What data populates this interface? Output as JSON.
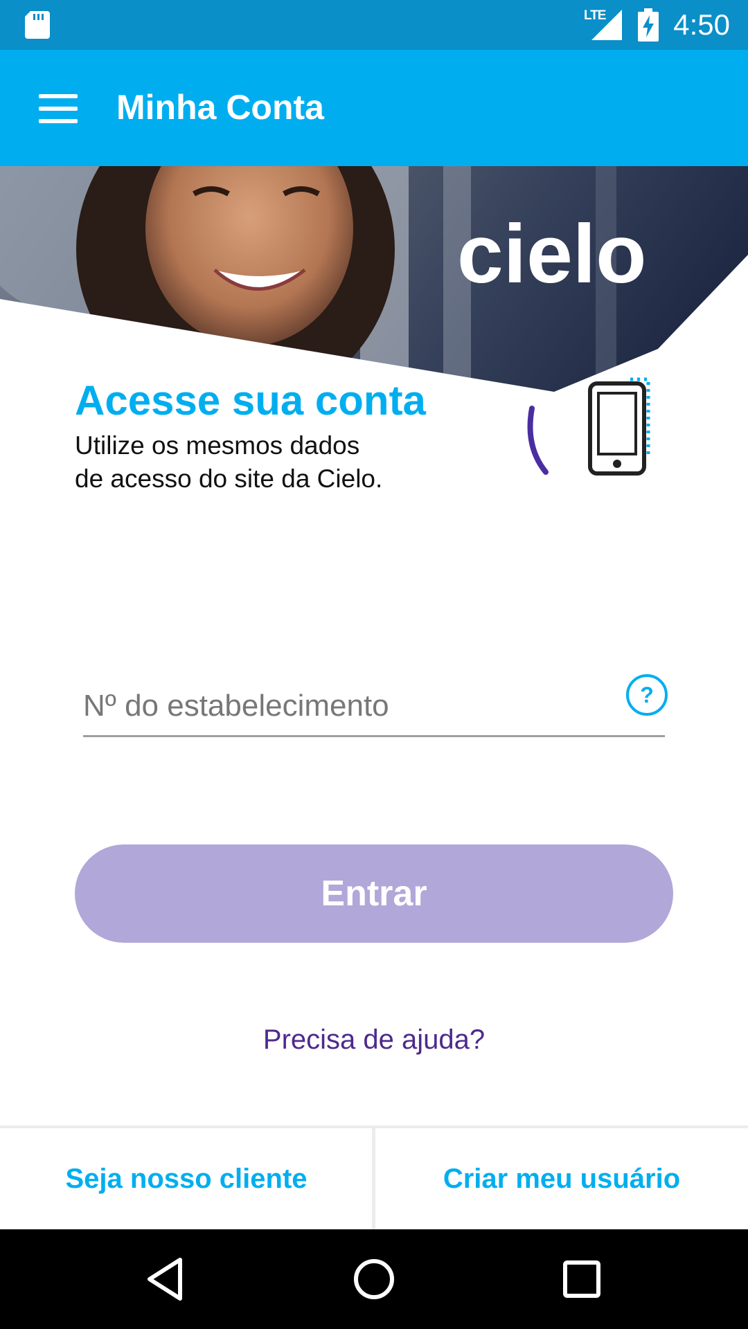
{
  "status_bar": {
    "time": "4:50",
    "network_label": "LTE",
    "icons": [
      "sd-card-icon",
      "lte-signal-icon",
      "battery-charging-icon"
    ]
  },
  "app_bar": {
    "title": "Minha Conta",
    "menu_icon": "menu-icon"
  },
  "hero": {
    "logo_text": "cielo",
    "headline": "Acesse sua conta",
    "subline_1": "Utilize os mesmos dados",
    "subline_2": "de acesso do site da Cielo."
  },
  "form": {
    "establishment_field": {
      "placeholder": "Nº do estabelecimento",
      "value": ""
    },
    "help_icon_label": "?",
    "submit_label": "Entrar",
    "help_link": "Precisa de ajuda?"
  },
  "bottom_links": {
    "left": "Seja nosso cliente",
    "right": "Criar meu usuário"
  },
  "nav_bar": {
    "buttons": [
      "back-icon",
      "home-icon",
      "recents-icon"
    ]
  },
  "colors": {
    "brand_blue": "#00aeef",
    "status_bar_blue": "#0a8fc8",
    "button_purple_disabled": "#b1a7d8",
    "link_purple": "#4d2a8d"
  }
}
